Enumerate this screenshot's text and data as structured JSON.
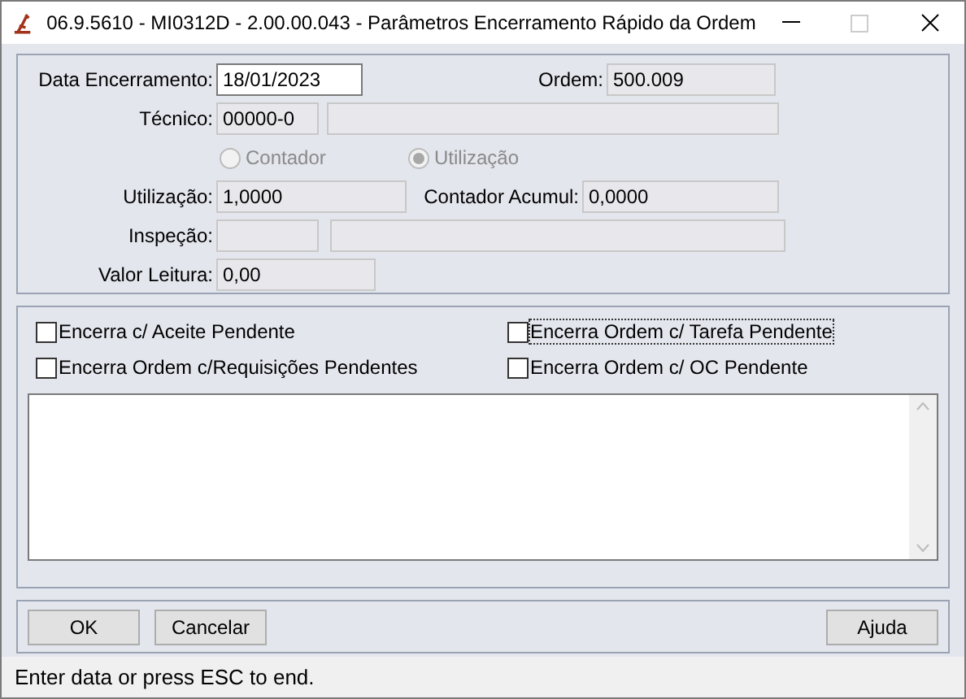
{
  "window": {
    "title": "06.9.5610 - MI0312D - 2.00.00.043 - Parâmetros Encerramento Rápido da Ordem"
  },
  "form": {
    "data_encerramento": {
      "label": "Data Encerramento:",
      "value": "18/01/2023",
      "disabled": false
    },
    "ordem": {
      "label": "Ordem:",
      "value": "500.009",
      "disabled": true
    },
    "tecnico": {
      "label": "Técnico:",
      "value": "00000-0",
      "disabled": true
    },
    "tecnico_nome": {
      "disabled": true
    },
    "radios": [
      {
        "label": "Contador",
        "selected": false,
        "disabled": true
      },
      {
        "label": "Utilização",
        "selected": true,
        "disabled": true
      }
    ],
    "utilizacao": {
      "label": "Utilização:",
      "value": "1,0000",
      "disabled": true
    },
    "contador_acumul": {
      "label": "Contador Acumul:",
      "value": "0,0000",
      "disabled": true
    },
    "inspecao": {
      "label": "Inspeção:",
      "disabled": true
    },
    "inspecao_desc": {
      "disabled": true
    },
    "valor_leitura": {
      "label": "Valor Leitura:",
      "value": "0,00",
      "disabled": true
    }
  },
  "options": [
    {
      "label": "Encerra c/ Aceite Pendente",
      "checked": false,
      "focused": false
    },
    {
      "label": "Encerra Ordem c/ Tarefa Pendente",
      "checked": false,
      "focused": true
    },
    {
      "label": "Encerra Ordem c/Requisições Pendentes",
      "checked": false,
      "focused": false
    },
    {
      "label": "Encerra Ordem c/ OC Pendente",
      "checked": false,
      "focused": false
    }
  ],
  "buttons": [
    {
      "label": "OK"
    },
    {
      "label": "Cancelar"
    },
    {
      "label": "Ajuda"
    }
  ],
  "status_bar": "Enter data or press ESC to end."
}
